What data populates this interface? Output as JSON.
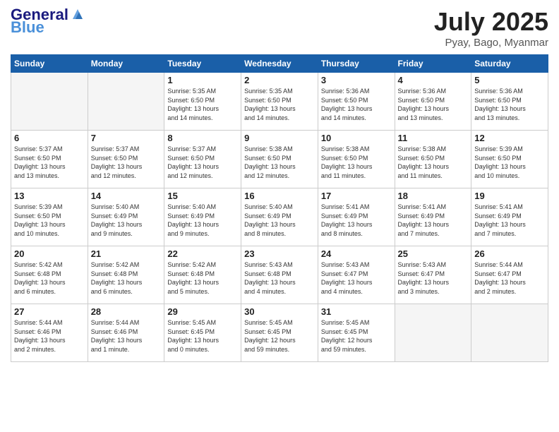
{
  "header": {
    "logo_line1": "General",
    "logo_line2": "Blue",
    "month": "July 2025",
    "location": "Pyay, Bago, Myanmar"
  },
  "weekdays": [
    "Sunday",
    "Monday",
    "Tuesday",
    "Wednesday",
    "Thursday",
    "Friday",
    "Saturday"
  ],
  "weeks": [
    [
      {
        "day": "",
        "info": ""
      },
      {
        "day": "",
        "info": ""
      },
      {
        "day": "1",
        "info": "Sunrise: 5:35 AM\nSunset: 6:50 PM\nDaylight: 13 hours\nand 14 minutes."
      },
      {
        "day": "2",
        "info": "Sunrise: 5:35 AM\nSunset: 6:50 PM\nDaylight: 13 hours\nand 14 minutes."
      },
      {
        "day": "3",
        "info": "Sunrise: 5:36 AM\nSunset: 6:50 PM\nDaylight: 13 hours\nand 14 minutes."
      },
      {
        "day": "4",
        "info": "Sunrise: 5:36 AM\nSunset: 6:50 PM\nDaylight: 13 hours\nand 13 minutes."
      },
      {
        "day": "5",
        "info": "Sunrise: 5:36 AM\nSunset: 6:50 PM\nDaylight: 13 hours\nand 13 minutes."
      }
    ],
    [
      {
        "day": "6",
        "info": "Sunrise: 5:37 AM\nSunset: 6:50 PM\nDaylight: 13 hours\nand 13 minutes."
      },
      {
        "day": "7",
        "info": "Sunrise: 5:37 AM\nSunset: 6:50 PM\nDaylight: 13 hours\nand 12 minutes."
      },
      {
        "day": "8",
        "info": "Sunrise: 5:37 AM\nSunset: 6:50 PM\nDaylight: 13 hours\nand 12 minutes."
      },
      {
        "day": "9",
        "info": "Sunrise: 5:38 AM\nSunset: 6:50 PM\nDaylight: 13 hours\nand 12 minutes."
      },
      {
        "day": "10",
        "info": "Sunrise: 5:38 AM\nSunset: 6:50 PM\nDaylight: 13 hours\nand 11 minutes."
      },
      {
        "day": "11",
        "info": "Sunrise: 5:38 AM\nSunset: 6:50 PM\nDaylight: 13 hours\nand 11 minutes."
      },
      {
        "day": "12",
        "info": "Sunrise: 5:39 AM\nSunset: 6:50 PM\nDaylight: 13 hours\nand 10 minutes."
      }
    ],
    [
      {
        "day": "13",
        "info": "Sunrise: 5:39 AM\nSunset: 6:50 PM\nDaylight: 13 hours\nand 10 minutes."
      },
      {
        "day": "14",
        "info": "Sunrise: 5:40 AM\nSunset: 6:49 PM\nDaylight: 13 hours\nand 9 minutes."
      },
      {
        "day": "15",
        "info": "Sunrise: 5:40 AM\nSunset: 6:49 PM\nDaylight: 13 hours\nand 9 minutes."
      },
      {
        "day": "16",
        "info": "Sunrise: 5:40 AM\nSunset: 6:49 PM\nDaylight: 13 hours\nand 8 minutes."
      },
      {
        "day": "17",
        "info": "Sunrise: 5:41 AM\nSunset: 6:49 PM\nDaylight: 13 hours\nand 8 minutes."
      },
      {
        "day": "18",
        "info": "Sunrise: 5:41 AM\nSunset: 6:49 PM\nDaylight: 13 hours\nand 7 minutes."
      },
      {
        "day": "19",
        "info": "Sunrise: 5:41 AM\nSunset: 6:49 PM\nDaylight: 13 hours\nand 7 minutes."
      }
    ],
    [
      {
        "day": "20",
        "info": "Sunrise: 5:42 AM\nSunset: 6:48 PM\nDaylight: 13 hours\nand 6 minutes."
      },
      {
        "day": "21",
        "info": "Sunrise: 5:42 AM\nSunset: 6:48 PM\nDaylight: 13 hours\nand 6 minutes."
      },
      {
        "day": "22",
        "info": "Sunrise: 5:42 AM\nSunset: 6:48 PM\nDaylight: 13 hours\nand 5 minutes."
      },
      {
        "day": "23",
        "info": "Sunrise: 5:43 AM\nSunset: 6:48 PM\nDaylight: 13 hours\nand 4 minutes."
      },
      {
        "day": "24",
        "info": "Sunrise: 5:43 AM\nSunset: 6:47 PM\nDaylight: 13 hours\nand 4 minutes."
      },
      {
        "day": "25",
        "info": "Sunrise: 5:43 AM\nSunset: 6:47 PM\nDaylight: 13 hours\nand 3 minutes."
      },
      {
        "day": "26",
        "info": "Sunrise: 5:44 AM\nSunset: 6:47 PM\nDaylight: 13 hours\nand 2 minutes."
      }
    ],
    [
      {
        "day": "27",
        "info": "Sunrise: 5:44 AM\nSunset: 6:46 PM\nDaylight: 13 hours\nand 2 minutes."
      },
      {
        "day": "28",
        "info": "Sunrise: 5:44 AM\nSunset: 6:46 PM\nDaylight: 13 hours\nand 1 minute."
      },
      {
        "day": "29",
        "info": "Sunrise: 5:45 AM\nSunset: 6:45 PM\nDaylight: 13 hours\nand 0 minutes."
      },
      {
        "day": "30",
        "info": "Sunrise: 5:45 AM\nSunset: 6:45 PM\nDaylight: 12 hours\nand 59 minutes."
      },
      {
        "day": "31",
        "info": "Sunrise: 5:45 AM\nSunset: 6:45 PM\nDaylight: 12 hours\nand 59 minutes."
      },
      {
        "day": "",
        "info": ""
      },
      {
        "day": "",
        "info": ""
      }
    ]
  ]
}
